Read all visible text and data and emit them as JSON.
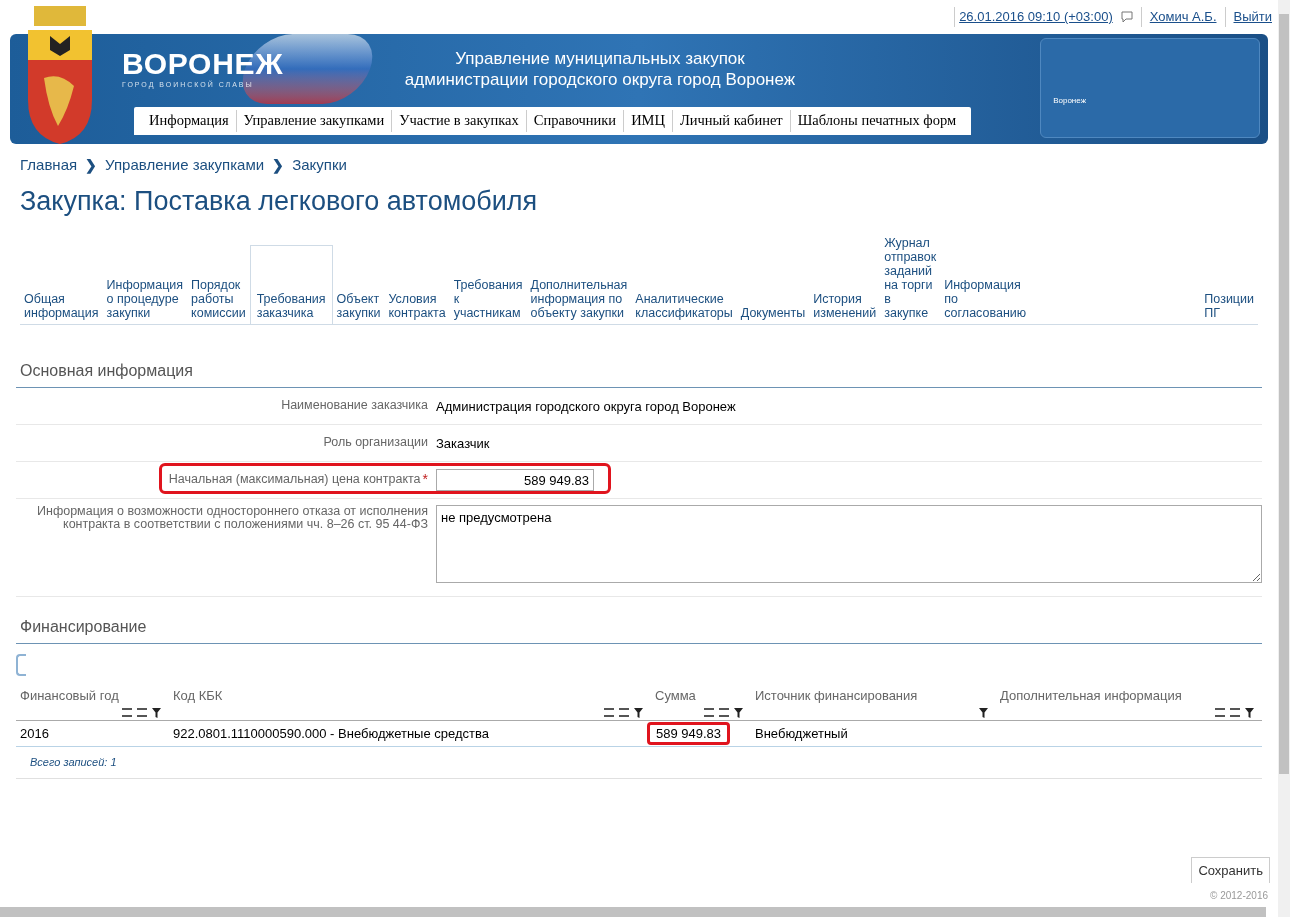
{
  "top_bar": {
    "datetime": "26.01.2016 09:10 (+03:00)",
    "user": "Хомич А.Б.",
    "logout": "Выйти"
  },
  "header": {
    "city": "ВОРОНЕЖ",
    "motto": "ГОРОД ВОИНСКОЙ СЛАВЫ",
    "title_lines": [
      "Управление муниципальных закупок",
      "администрации городского округа город Воронеж"
    ],
    "map_label": "Воронеж",
    "menu": [
      "Информация",
      "Управление закупками",
      "Участие в закупках",
      "Справочники",
      "ИМЦ",
      "Личный кабинет",
      "Шаблоны печатных форм"
    ]
  },
  "breadcrumbs": {
    "separator": "❯",
    "items": [
      "Главная",
      "Управление закупками",
      "Закупки"
    ]
  },
  "page_title": "Закупка: Поставка легкового автомобиля",
  "tabs": [
    {
      "label": "Общая\nинформация",
      "selected": false
    },
    {
      "label": "Информация\nо процедуре\nзакупки",
      "selected": false
    },
    {
      "label": "Порядок\nработы\nкомиссии",
      "selected": false
    },
    {
      "label": "Требования\nзаказчика",
      "selected": true
    },
    {
      "label": "Объект\nзакупки",
      "selected": false
    },
    {
      "label": "Условия\nконтракта",
      "selected": false
    },
    {
      "label": "Требования\nк\nучастникам",
      "selected": false
    },
    {
      "label": "Дополнительная\nинформация по\nобъекту закупки",
      "selected": false
    },
    {
      "label": "Аналитические\nклассификаторы",
      "selected": false
    },
    {
      "label": "Документы",
      "selected": false
    },
    {
      "label": "История\nизменений",
      "selected": false
    },
    {
      "label": "Журнал\nотправок\nзаданий\nна торги\nв\nзакупке",
      "selected": false
    },
    {
      "label": "Информация\nпо\nсогласованию",
      "selected": false
    },
    {
      "label": "Позиции\nПГ",
      "selected": false
    }
  ],
  "main_info": {
    "title": "Основная информация",
    "fields": [
      {
        "kind": "text",
        "label": "Наименование заказчика",
        "value": "Администрация городского округа город Воронеж",
        "highlighted": false
      },
      {
        "kind": "text",
        "label": "Роль организации",
        "value": "Заказчик",
        "highlighted": false
      },
      {
        "kind": "input",
        "label": "Начальная (максимальная) цена контракта",
        "required_mark": "*",
        "value": "589 949.83",
        "highlighted": true
      },
      {
        "kind": "textarea",
        "label": "Информация о возможности одностороннего отказа от исполнения\nконтракта в соответствии с положениями чч. 8–26 ст. 95 44-ФЗ",
        "value": "не предусмотрена",
        "highlighted": false
      }
    ]
  },
  "financing": {
    "title": "Финансирование",
    "columns": [
      {
        "label": "Финансовый год",
        "sortable": true,
        "filterable": true
      },
      {
        "label": "Код КБК",
        "sortable": true,
        "filterable": true
      },
      {
        "label": "Сумма",
        "sortable": true,
        "filterable": true
      },
      {
        "label": "Источник финансирования",
        "sortable": false,
        "filterable": true
      },
      {
        "label": "Дополнительная информация",
        "sortable": true,
        "filterable": true
      }
    ],
    "rows": [
      {
        "cells": [
          {
            "text": "2016",
            "highlighted": false
          },
          {
            "text": "922.0801.1110000590.000 - Внебюджетные средства",
            "highlighted": false
          },
          {
            "text": "589 949.83",
            "highlighted": true
          },
          {
            "text": "Внебюджетный",
            "highlighted": false
          }
        ]
      }
    ],
    "footer": "Всего записей: 1"
  },
  "save_button": "Сохранить",
  "copyright": "© 2012-2016"
}
